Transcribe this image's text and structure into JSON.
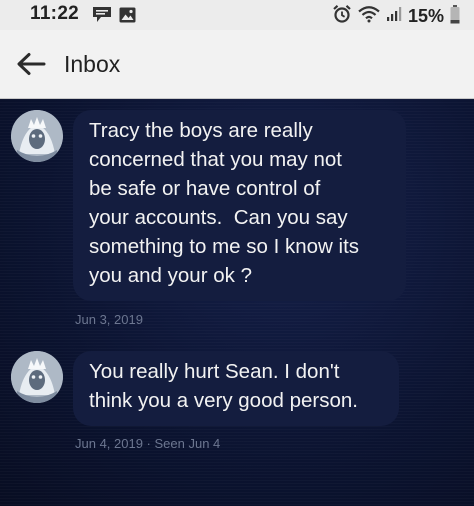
{
  "status_bar": {
    "time": "11:22",
    "left_icons": [
      "chat-bubble-icon",
      "image-icon"
    ],
    "right_icons": [
      "alarm-icon",
      "wifi-icon",
      "signal-icon",
      "battery-icon"
    ],
    "battery": "15%"
  },
  "header": {
    "back_icon": "arrow-left-icon",
    "title": "Inbox"
  },
  "messages": [
    {
      "lines": [
        "Tracy the boys are really",
        "concerned that you may not",
        "be safe or have control of",
        "your accounts.  Can you say",
        "something to me so I know its",
        "you and your ok ?"
      ],
      "timestamp": "Jun 3, 2019"
    },
    {
      "lines": [
        "You really hurt Sean. I don't",
        "think you a very good person."
      ],
      "timestamp": "Jun 4, 2019 · Seen Jun 4"
    }
  ],
  "colors": {
    "background": "#0d1530",
    "bubble": "#141d3f",
    "message_text": "#f2f2f2",
    "timestamp_text": "#6c7690",
    "header_bg": "#f2f2f2"
  }
}
